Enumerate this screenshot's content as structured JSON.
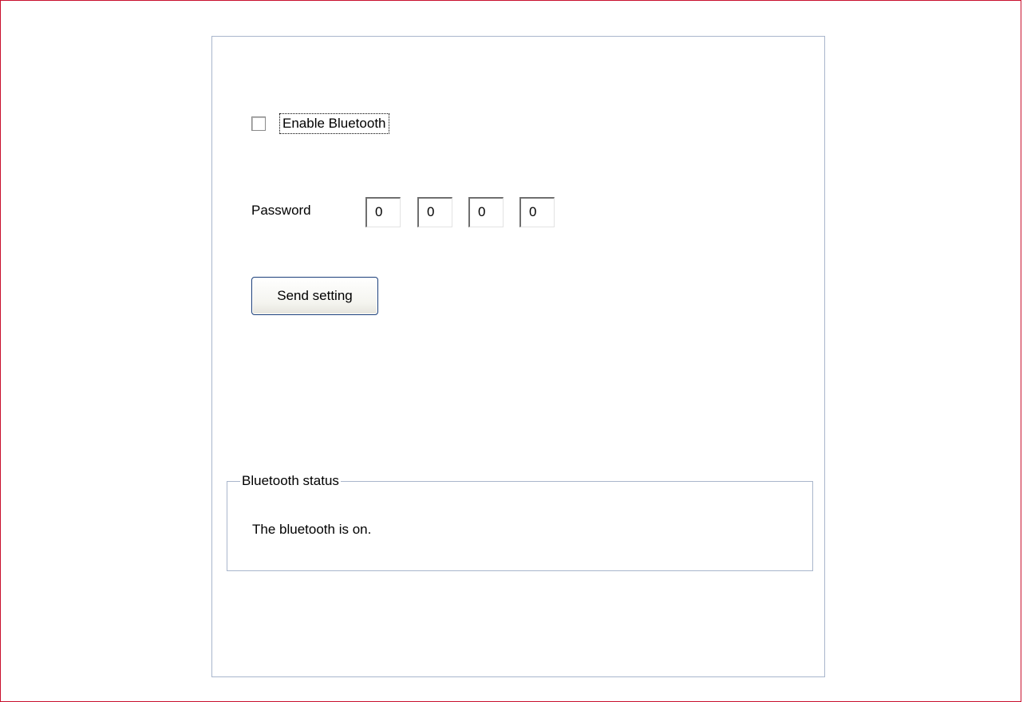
{
  "bluetooth": {
    "enable_label": "Enable Bluetooth",
    "enabled": false
  },
  "password": {
    "label": "Password",
    "digits": [
      "0",
      "0",
      "0",
      "0"
    ]
  },
  "send_button_label": "Send setting",
  "status": {
    "group_title": "Bluetooth status",
    "message": "The bluetooth is on."
  },
  "colors": {
    "frame_border": "#c8102e",
    "panel_border": "#a9b6cc",
    "button_border": "#1b3f7a"
  }
}
